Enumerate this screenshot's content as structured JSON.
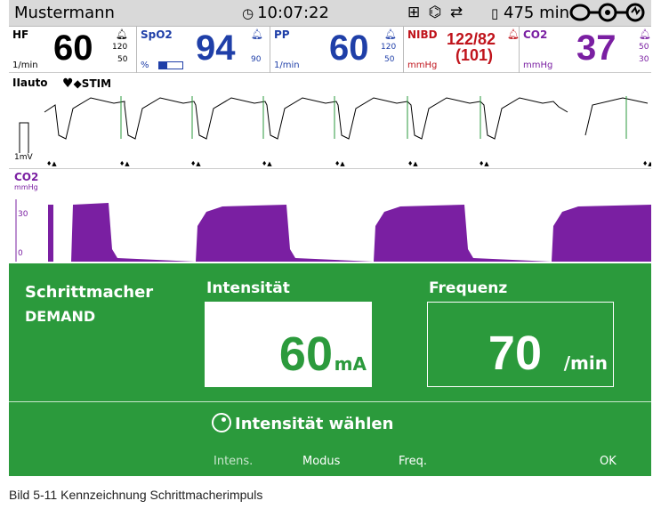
{
  "status": {
    "patient": "Mustermann",
    "time": "10:07:22",
    "battery": "475 min",
    "icons": [
      "ecg-lead-icon",
      "wireless-icon",
      "transfer-icon",
      "battery-icon",
      "connection-icon"
    ]
  },
  "params": {
    "hf": {
      "label": "HF",
      "value": "60",
      "unit": "1/min",
      "upper": "120",
      "lower": "50"
    },
    "spo2": {
      "label": "SpO2",
      "value": "94",
      "unit": "%",
      "lower": "90",
      "signal_level": 0.35
    },
    "pp": {
      "label": "PP",
      "value": "60",
      "unit": "1/min",
      "upper": "120",
      "lower": "50"
    },
    "nibd": {
      "label": "NIBD",
      "value": "122/82",
      "mean": "(101)",
      "unit": "mmHg"
    },
    "co2": {
      "label": "CO2",
      "value": "37",
      "unit": "mmHg",
      "upper": "50",
      "lower": "30"
    }
  },
  "ecg": {
    "lead": "IIauto",
    "stim": "STIM",
    "scale": "1mV"
  },
  "co2wave": {
    "label": "CO2",
    "unit": "mmHg",
    "tick_high": "30",
    "tick_low": "0"
  },
  "pacer": {
    "title": "Schrittmacher",
    "mode": "DEMAND",
    "intensity_label": "Intensität",
    "intensity_value": "60",
    "intensity_unit": "mA",
    "frequency_label": "Frequenz",
    "frequency_value": "70",
    "frequency_unit": "/min",
    "prompt": "Intensität wählen"
  },
  "softkeys": [
    "Intens.",
    "Modus",
    "Freq.",
    "OK"
  ],
  "caption": "Bild 5-11    Kennzeichnung Schrittmacherimpuls",
  "colors": {
    "pacer_bg": "#2b9a3c",
    "hf": "#000000",
    "spo2": "#1f3fa8",
    "pp": "#1f3fa8",
    "nibd": "#c0141c",
    "co2": "#7a1fa2"
  }
}
